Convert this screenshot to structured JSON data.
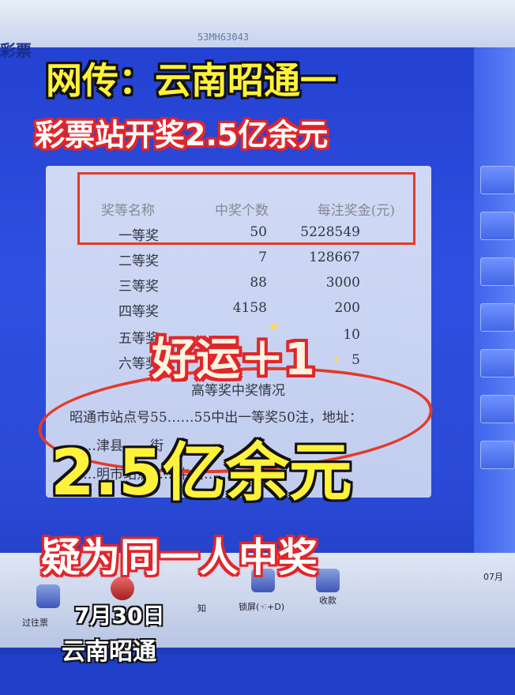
{
  "topbar": {
    "logo": "彩票",
    "code": "53MH63043"
  },
  "table": {
    "headers": {
      "name": "奖等名称",
      "count": "中奖个数",
      "prize": "每注奖金(元)"
    },
    "rows": [
      {
        "name": "一等奖",
        "count": "50",
        "prize": "5228549"
      },
      {
        "name": "二等奖",
        "count": "7",
        "prize": "128667"
      },
      {
        "name": "三等奖",
        "count": "88",
        "prize": "3000"
      },
      {
        "name": "四等奖",
        "count": "4158",
        "prize": "200"
      },
      {
        "name": "五等奖",
        "count": "",
        "prize": "10"
      },
      {
        "name": "六等奖",
        "count": "",
        "prize": "5"
      }
    ],
    "section_title": "高等奖中奖情况",
    "notes": [
      "昭通市站点号55……55中出一等奖50注，地址：",
      "……津县……街",
      "……明市站点……中出……"
    ]
  },
  "taskbar": {
    "items": [
      {
        "label": "过往票"
      },
      {
        "label": "知"
      },
      {
        "label": "锁屏(☜+D)"
      },
      {
        "label": "收款"
      },
      {
        "label": "07月"
      }
    ]
  },
  "captions": {
    "headline_line1": "网传：云南昭通一",
    "headline_line2": "彩票站开奖2.5亿余元",
    "lucky": "好运＋1",
    "big_amount": "2.5亿余元",
    "subline": "疑为同一人中奖",
    "date": "7月30日",
    "place": "云南昭通"
  },
  "colors": {
    "accent_yellow": "#fff23a",
    "accent_red": "#e0262a",
    "screen_blue": "#2a49d6"
  }
}
